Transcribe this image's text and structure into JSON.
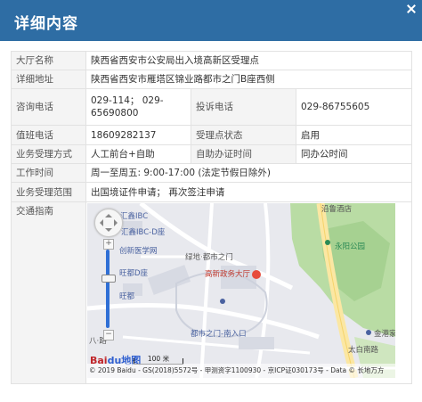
{
  "header": {
    "title": "详细内容"
  },
  "detail": {
    "hall_name": {
      "label": "大厅名称",
      "value": "陕西省西安市公安局出入境高新区受理点"
    },
    "address": {
      "label": "详细地址",
      "value": "陕西省西安市雁塔区锦业路都市之门B座西侧"
    },
    "phone": {
      "label": "咨询电话",
      "value_line1": "029-114； 029-",
      "value_line2": "65690800",
      "complaint_label": "投诉电话",
      "complaint_value": "029-86755605"
    },
    "duty": {
      "label": "值班电话",
      "value": "18609282137",
      "status_label": "受理点状态",
      "status_value": "启用"
    },
    "method": {
      "label": "业务受理方式",
      "value": "人工前台+自助",
      "self_label": "自助办证时间",
      "self_value": "同办公时间"
    },
    "hours": {
      "label": "工作时间",
      "value": "周一至周五: 9:00-17:00  (法定节假日除外)"
    },
    "scope": {
      "label": "业务受理范围",
      "value": "出国境证件申请； 再次签注申请"
    },
    "traffic": {
      "label": "交通指南"
    }
  },
  "map": {
    "labels": {
      "a": "沿鲁酒店",
      "b": "汇鑫IBC",
      "c": "汇鑫IBC-D座",
      "d": "永阳公园",
      "e": "创新医学网",
      "f": "绿地·都市之门",
      "g": "旺都D座",
      "h": "高新政务大厅",
      "i": "旺都",
      "j": "都市之门-南入口",
      "k": "金港家",
      "l": "太白南路",
      "m": "八·路"
    },
    "scale": "100 米",
    "brand_a": "Bai",
    "brand_b": "du地图",
    "copyright": "© 2019 Baidu - GS(2018)5572号 - 甲测资字1100930 - 京ICP证030173号 - Data © 长地万方"
  }
}
